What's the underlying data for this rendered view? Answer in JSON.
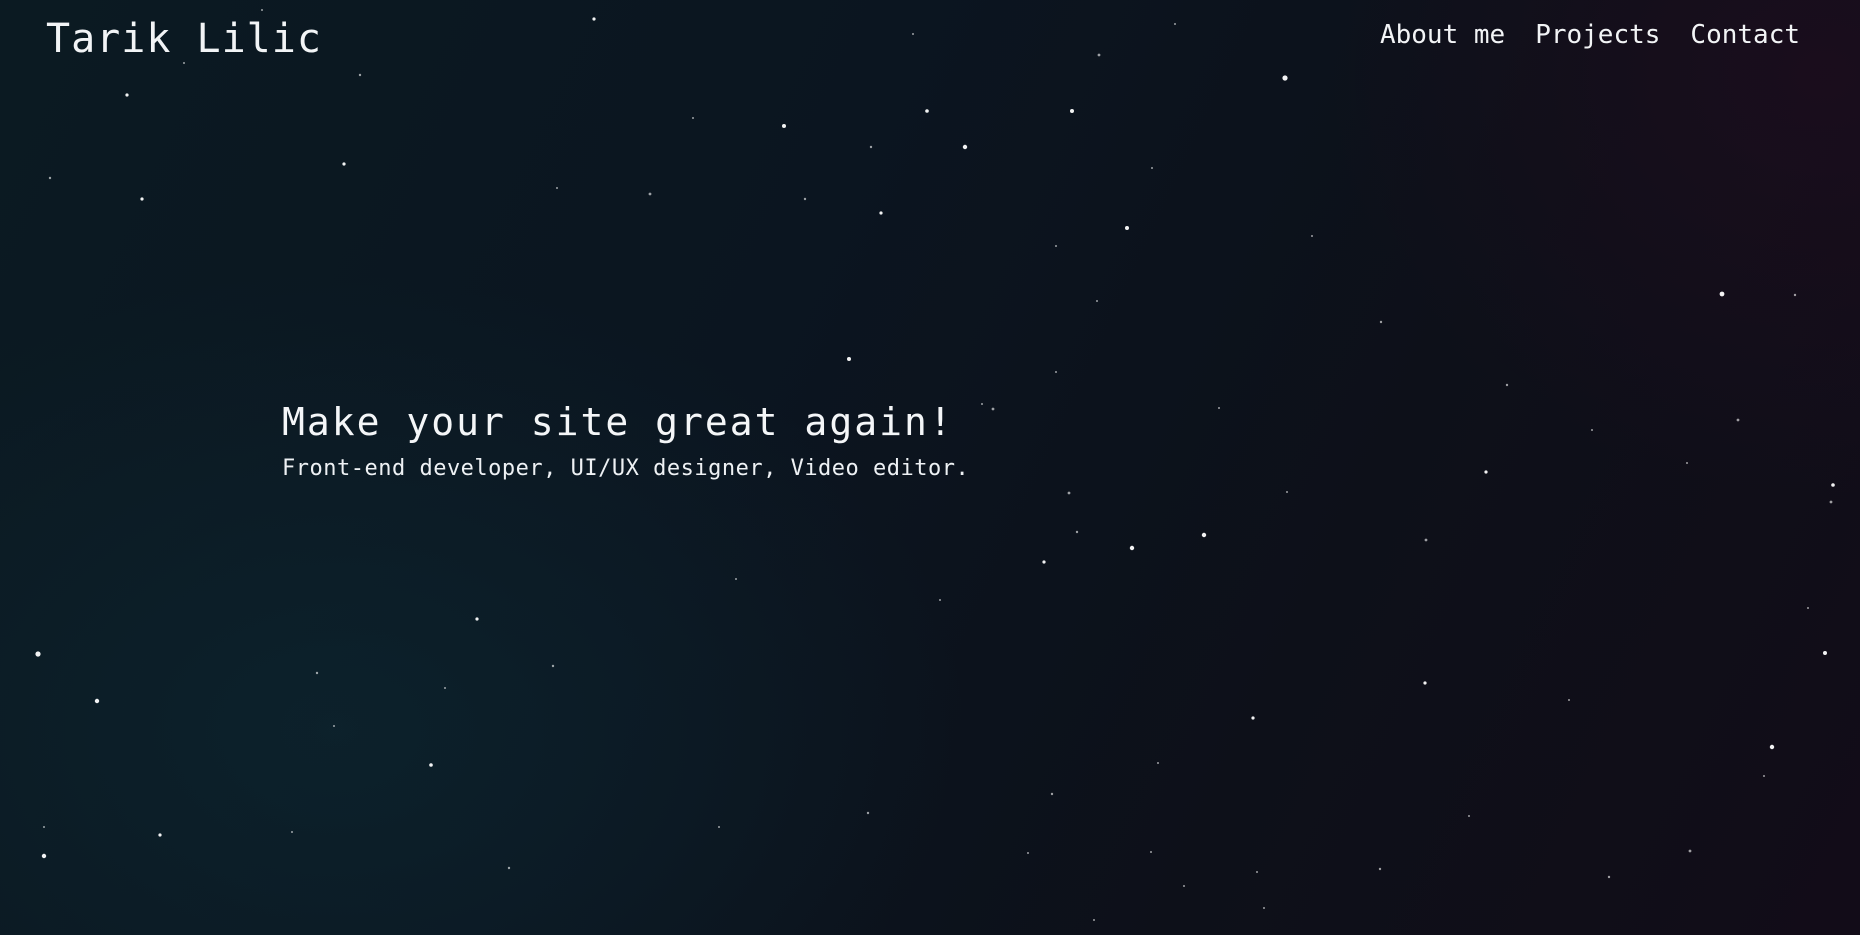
{
  "header": {
    "brand": "Tarik Lilic",
    "nav": [
      {
        "label": "About me"
      },
      {
        "label": "Projects"
      },
      {
        "label": "Contact"
      }
    ]
  },
  "hero": {
    "title": "Make your site great again!",
    "subtitle": "Front-end developer, UI/UX designer, Video editor."
  },
  "theme": {
    "text_color": "#ffffff",
    "background": "#0b1520",
    "star_color": "#ffffff"
  }
}
